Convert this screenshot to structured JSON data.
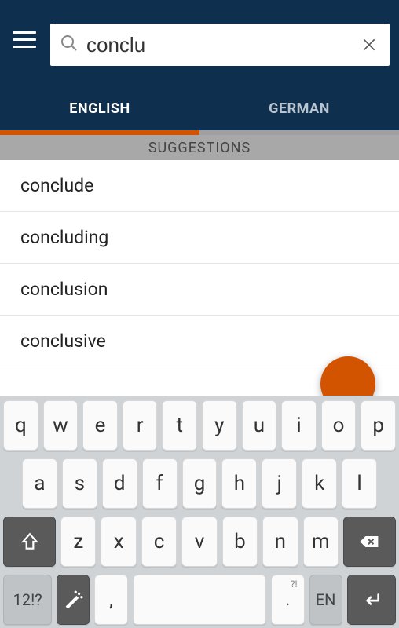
{
  "header": {
    "search_value": "conclu"
  },
  "tabs": {
    "english": "ENGLISH",
    "german": "GERMAN",
    "active_index": 0
  },
  "suggestions": {
    "header": "SUGGESTIONS",
    "items": [
      "conclude",
      "concluding",
      "conclusion",
      "conclusive"
    ]
  },
  "keyboard": {
    "row1": [
      "q",
      "w",
      "e",
      "r",
      "t",
      "y",
      "u",
      "i",
      "o",
      "p"
    ],
    "row2": [
      "a",
      "s",
      "d",
      "f",
      "g",
      "h",
      "j",
      "k",
      "l"
    ],
    "row3": [
      "z",
      "x",
      "c",
      "v",
      "b",
      "n",
      "m"
    ],
    "sym_label": "12!?",
    "comma": ",",
    "period": ".",
    "period_sup": "?!",
    "lang": "EN"
  }
}
